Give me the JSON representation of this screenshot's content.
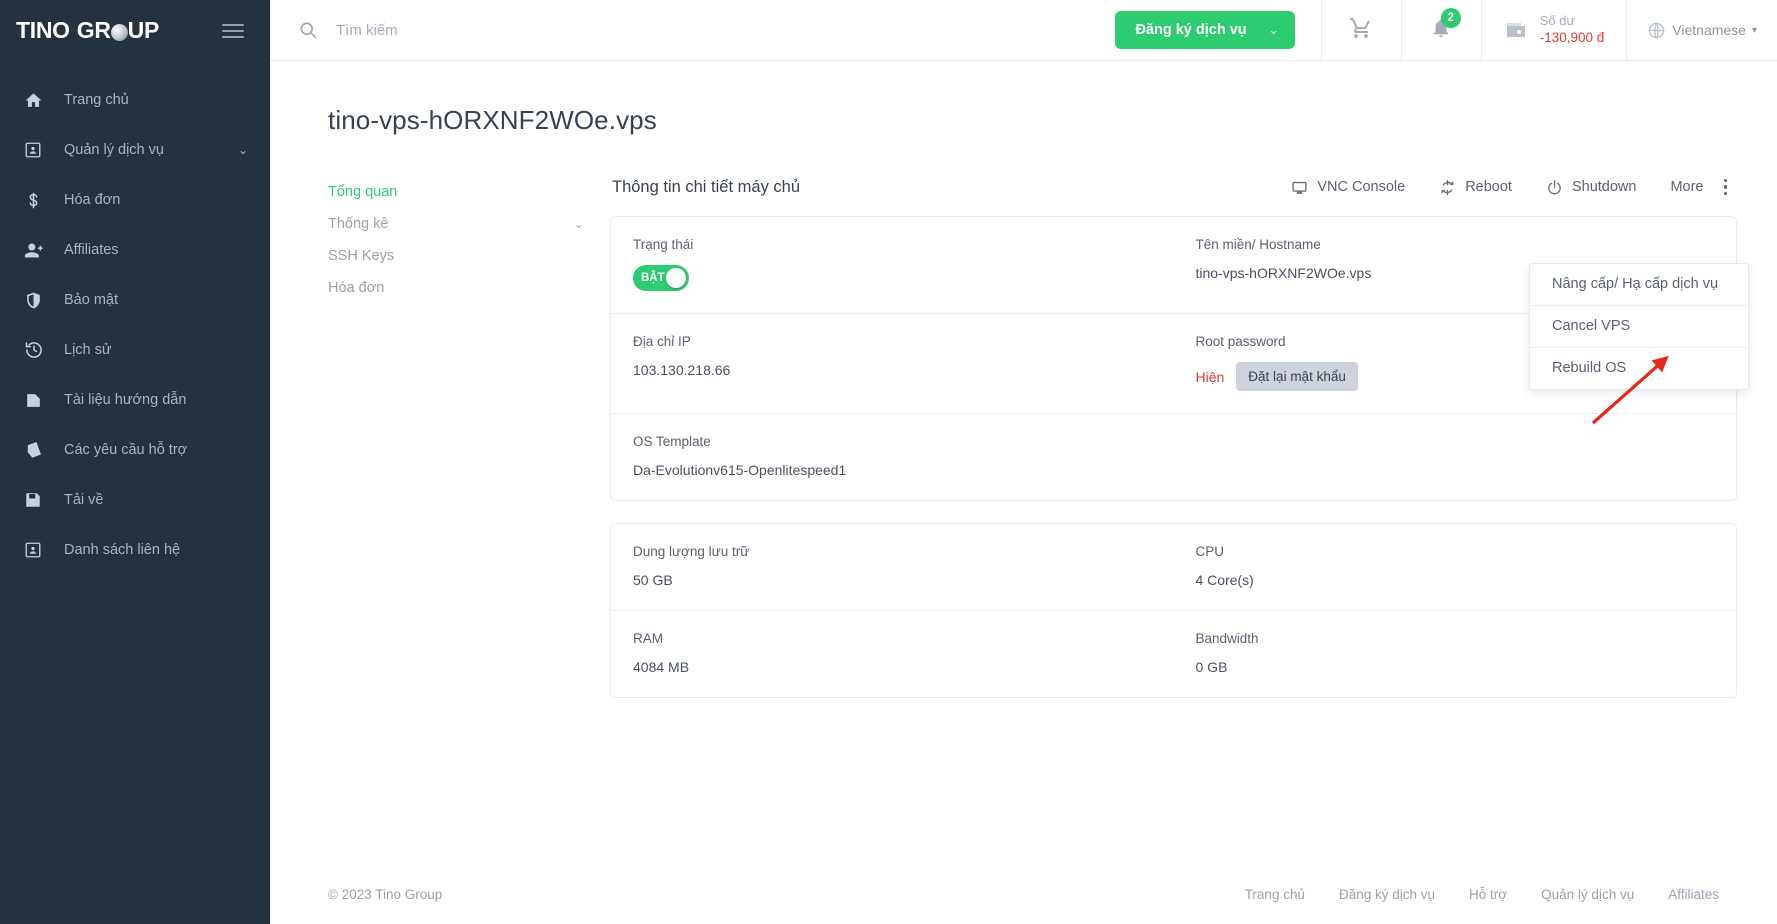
{
  "brand": {
    "name_part1": "TINO",
    "name_part2": "GR",
    "name_part3": "UP"
  },
  "sidebar": {
    "items": [
      {
        "label": "Trang chủ",
        "icon": "home-icon",
        "chevron": ""
      },
      {
        "label": "Quản lý dịch vụ",
        "icon": "service-card-icon",
        "chevron": "⌄"
      },
      {
        "label": "Hóa đơn",
        "icon": "dollar-icon",
        "chevron": ""
      },
      {
        "label": "Affiliates",
        "icon": "person-add-icon",
        "chevron": ""
      },
      {
        "label": "Bảo mật",
        "icon": "shield-icon",
        "chevron": ""
      },
      {
        "label": "Lịch sử",
        "icon": "history-icon",
        "chevron": ""
      },
      {
        "label": "Tài liệu hướng dẫn",
        "icon": "document-icon",
        "chevron": ""
      },
      {
        "label": "Các yêu cầu hỗ trợ",
        "icon": "ticket-icon",
        "chevron": ""
      },
      {
        "label": "Tải về",
        "icon": "save-icon",
        "chevron": ""
      },
      {
        "label": "Danh sách liên hệ",
        "icon": "contact-card-icon",
        "chevron": ""
      }
    ]
  },
  "topbar": {
    "search_placeholder": "Tìm kiếm",
    "search_value": "",
    "register_label": "Đăng ký dịch vụ",
    "register_caret": "⌄",
    "cart_icon": "cart-icon",
    "bell_icon": "bell-icon",
    "notification_count": "2",
    "balance_label": "Số dư",
    "balance_value": "-130,900 đ",
    "language": "Vietnamese",
    "language_caret": "▾"
  },
  "page": {
    "title": "tino-vps-hORXNF2WOe.vps"
  },
  "subnav": {
    "items": [
      {
        "label": "Tổng quan",
        "active": true,
        "chev": ""
      },
      {
        "label": "Thống kê",
        "active": false,
        "chev": "⌄"
      },
      {
        "label": "SSH Keys",
        "active": false,
        "chev": ""
      },
      {
        "label": "Hóa đơn",
        "active": false,
        "chev": ""
      }
    ]
  },
  "detail": {
    "title": "Thông tin chi tiết máy chủ",
    "actions": {
      "vnc": "VNC Console",
      "reboot": "Reboot",
      "shutdown": "Shutdown",
      "more": "More"
    },
    "dropdown": {
      "items": [
        {
          "label": "Nâng cấp/ Hạ cấp dịch vụ"
        },
        {
          "label": "Cancel VPS"
        },
        {
          "label": "Rebuild OS"
        }
      ]
    },
    "fields": {
      "status_label": "Trạng thái",
      "status_toggle_text": "BẬT",
      "hostname_label": "Tên miền/ Hostname",
      "hostname_value": "tino-vps-hORXNF2WOe.vps",
      "ip_label": "Địa chỉ IP",
      "ip_value": "103.130.218.66",
      "rootpw_label": "Root password",
      "rootpw_show": "Hiện",
      "rootpw_reset": "Đặt lại mật khẩu",
      "os_label": "OS Template",
      "os_value": "Da-Evolutionv615-Openlitespeed1",
      "storage_label": "Dung lượng lưu trữ",
      "storage_value": "50 GB",
      "cpu_label": "CPU",
      "cpu_value": "4 Core(s)",
      "ram_label": "RAM",
      "ram_value": "4084 MB",
      "bandwidth_label": "Bandwidth",
      "bandwidth_value": "0 GB"
    }
  },
  "footer": {
    "copyright": "© 2023 Tino Group",
    "links": [
      "Trang chủ",
      "Đăng ký dịch vụ",
      "Hỗ trợ",
      "Quản lý dịch vụ",
      "Affiliates"
    ]
  },
  "colors": {
    "accent_green": "#2ecc71",
    "sidebar_bg": "#26313f",
    "danger_red": "#e53935",
    "annotation_red": "#e8271b"
  }
}
